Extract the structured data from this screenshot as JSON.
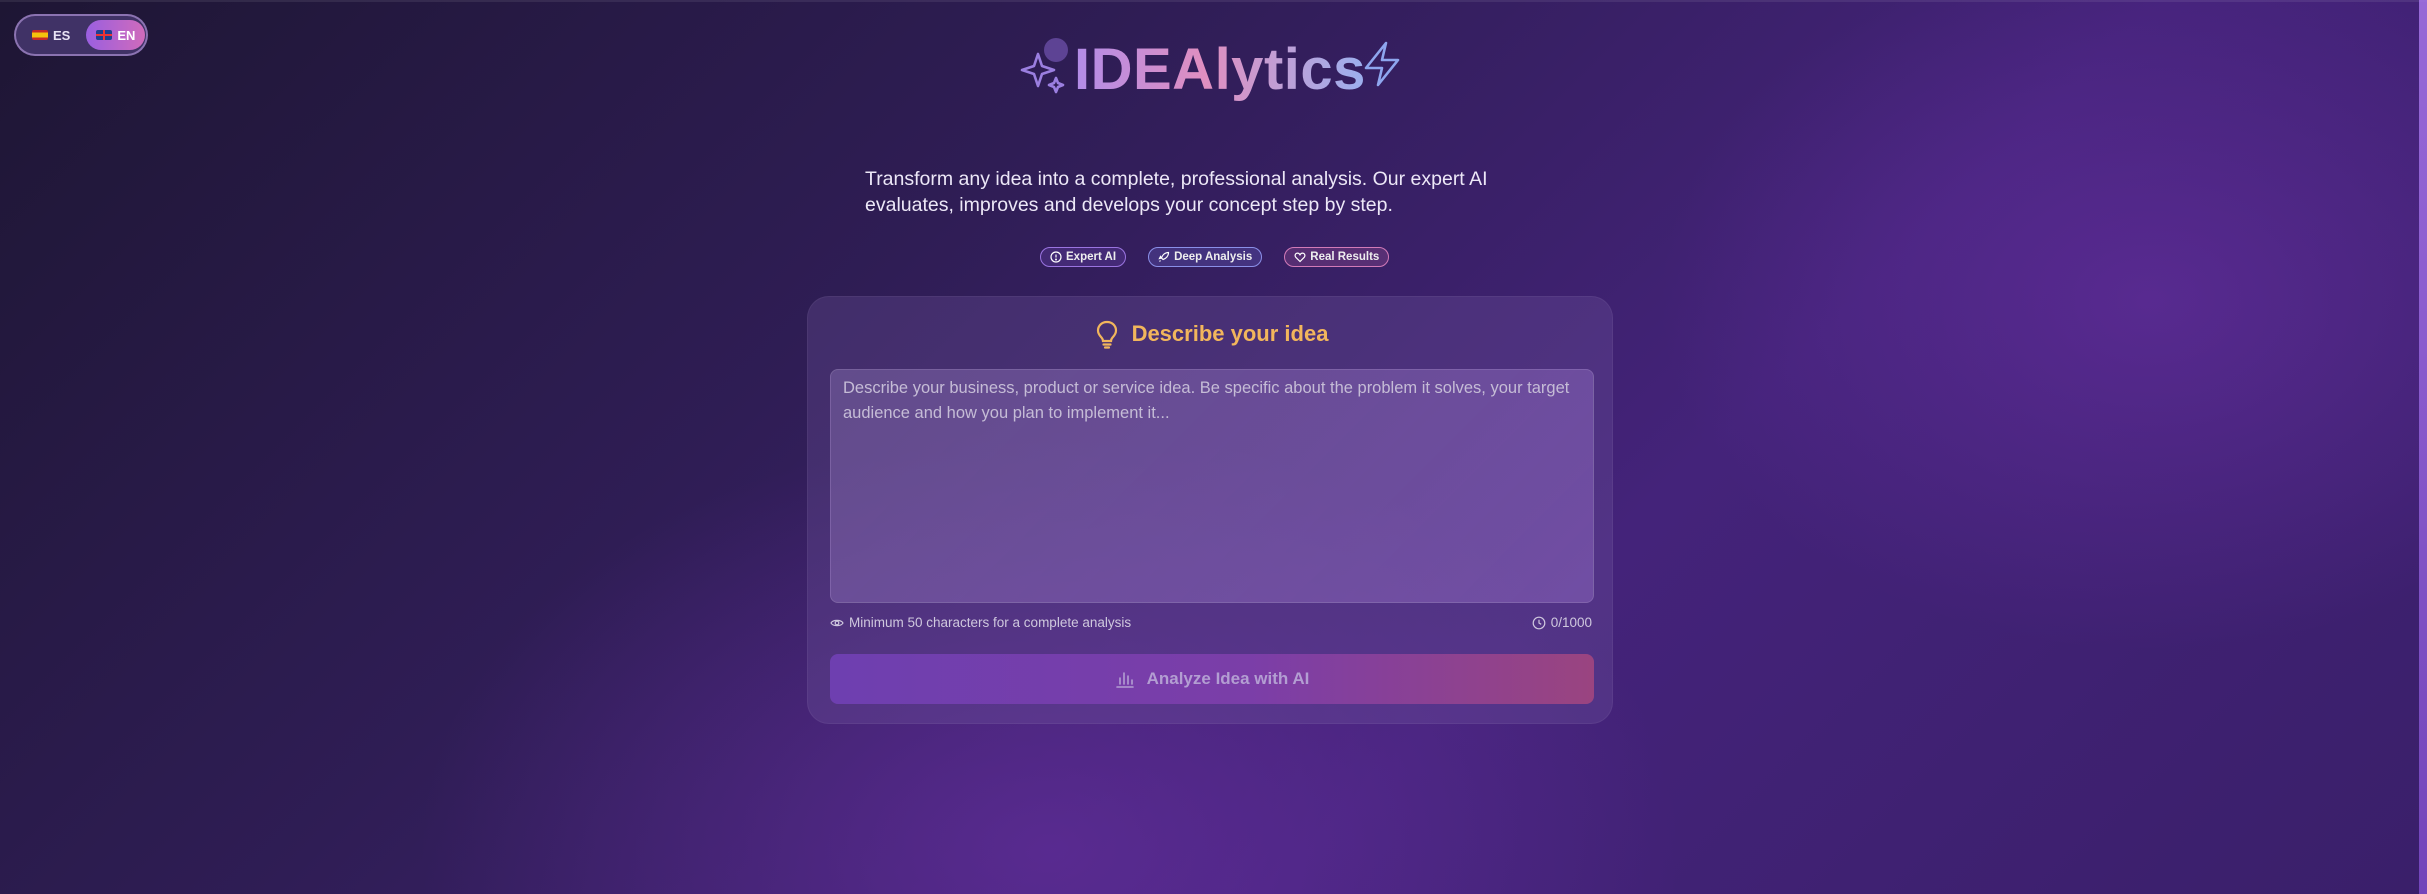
{
  "language_switch": {
    "options": [
      {
        "code": "ES",
        "flag": "spain-flag",
        "active": false
      },
      {
        "code": "EN",
        "flag": "uk-flag",
        "active": true
      }
    ]
  },
  "header": {
    "title": "IDEAlytics",
    "tagline": "Transform any idea into a complete, professional analysis. Our expert AI evaluates, improves and develops your concept step by step."
  },
  "badges": [
    {
      "label": "Expert AI",
      "icon": "info-circle-icon"
    },
    {
      "label": "Deep Analysis",
      "icon": "rocket-icon"
    },
    {
      "label": "Real Results",
      "icon": "heart-icon"
    }
  ],
  "idea_card": {
    "title": "Describe your idea",
    "placeholder": "Describe your business, product or service idea. Be specific about the problem it solves, your target audience and how you plan to implement it...",
    "hint": "Minimum 50 characters for a complete analysis",
    "char_count": "0/1000",
    "submit_label": "Analyze Idea with AI"
  },
  "colors": {
    "accent_gold": "#f2b65c",
    "accent_purple": "#9a5fe0",
    "accent_pink": "#d06bbb"
  }
}
